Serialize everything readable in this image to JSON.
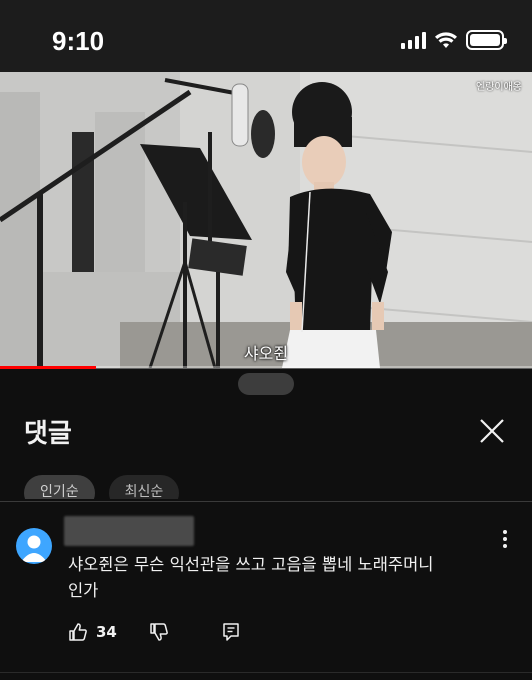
{
  "status_bar": {
    "time": "9:10"
  },
  "video": {
    "channel_tag": "엔랑이애옹",
    "subtitle": "샤오쥔",
    "progress": 0.18
  },
  "comments": {
    "title": "댓글",
    "chips": [
      "인기순",
      "최신순"
    ],
    "items": [
      {
        "text_line1": "샤오쥔은 무슨 익선관을 쓰고 고음을 뽑네 노래주머니",
        "text_line2": "인가",
        "likes": "34"
      }
    ]
  },
  "colors": {
    "accent": "#ff0000",
    "avatar": "#3ea6ff",
    "background": "#0f0f0f"
  }
}
